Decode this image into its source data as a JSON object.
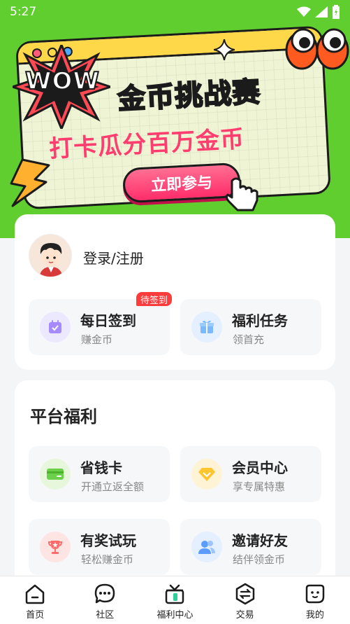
{
  "status_bar": {
    "time": "5:27"
  },
  "banner": {
    "wow": "WOW",
    "title": "金币挑战赛",
    "subtitle": "打卡瓜分百万金币",
    "join_button": "立即参与",
    "colors": {
      "background": "#5fce2e",
      "accent": "#ff2d6a",
      "card_top": "#ffd84a"
    }
  },
  "profile": {
    "login_label": "登录/注册",
    "tasks": [
      {
        "title": "每日签到",
        "subtitle": "赚金币",
        "badge": "待签到",
        "icon": "calendar-check-icon"
      },
      {
        "title": "福利任务",
        "subtitle": "领首充",
        "icon": "gift-icon"
      }
    ]
  },
  "benefits": {
    "title": "平台福利",
    "items": [
      {
        "title": "省钱卡",
        "subtitle": "开通立返全额",
        "icon": "card-icon"
      },
      {
        "title": "会员中心",
        "subtitle": "享专属特惠",
        "icon": "diamond-icon"
      },
      {
        "title": "有奖试玩",
        "subtitle": "轻松赚金币",
        "icon": "trophy-icon"
      },
      {
        "title": "邀请好友",
        "subtitle": "结伴领金币",
        "icon": "friends-icon"
      }
    ]
  },
  "bottom_nav": {
    "items": [
      {
        "label": "首页",
        "icon": "home-icon"
      },
      {
        "label": "社区",
        "icon": "chat-icon"
      },
      {
        "label": "福利中心",
        "icon": "gift-box-icon"
      },
      {
        "label": "交易",
        "icon": "exchange-icon"
      },
      {
        "label": "我的",
        "icon": "profile-face-icon"
      }
    ]
  }
}
